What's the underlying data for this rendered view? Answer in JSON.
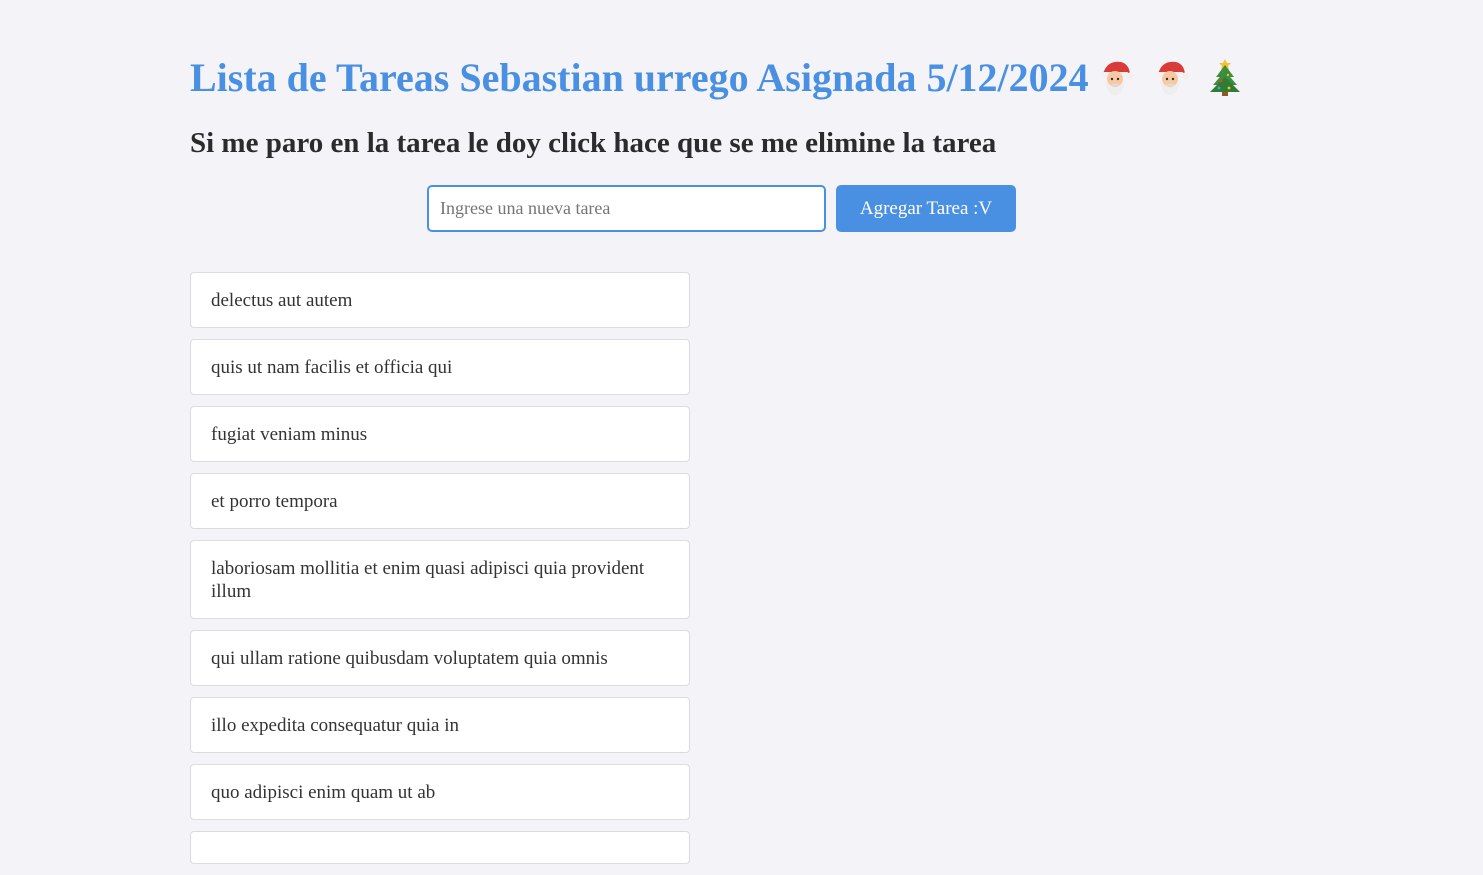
{
  "header": {
    "title": "Lista de Tareas Sebastian urrego Asignada 5/12/2024",
    "emojis": [
      "santa-icon",
      "santa-icon",
      "christmas-tree-icon"
    ],
    "subtitle": "Si me paro en la tarea le doy click hace que se me elimine la tarea"
  },
  "form": {
    "input_placeholder": "Ingrese una nueva tarea",
    "input_value": "",
    "add_button_label": "Agregar Tarea :V"
  },
  "tasks": [
    {
      "label": "delectus aut autem"
    },
    {
      "label": "quis ut nam facilis et officia qui"
    },
    {
      "label": "fugiat veniam minus"
    },
    {
      "label": "et porro tempora"
    },
    {
      "label": "laboriosam mollitia et enim quasi adipisci quia provident illum"
    },
    {
      "label": "qui ullam ratione quibusdam voluptatem quia omnis"
    },
    {
      "label": "illo expedita consequatur quia in"
    },
    {
      "label": "quo adipisci enim quam ut ab"
    },
    {
      "label": ""
    }
  ],
  "colors": {
    "accent": "#4a90e2",
    "background": "#f4f4f8",
    "text": "#333333"
  }
}
